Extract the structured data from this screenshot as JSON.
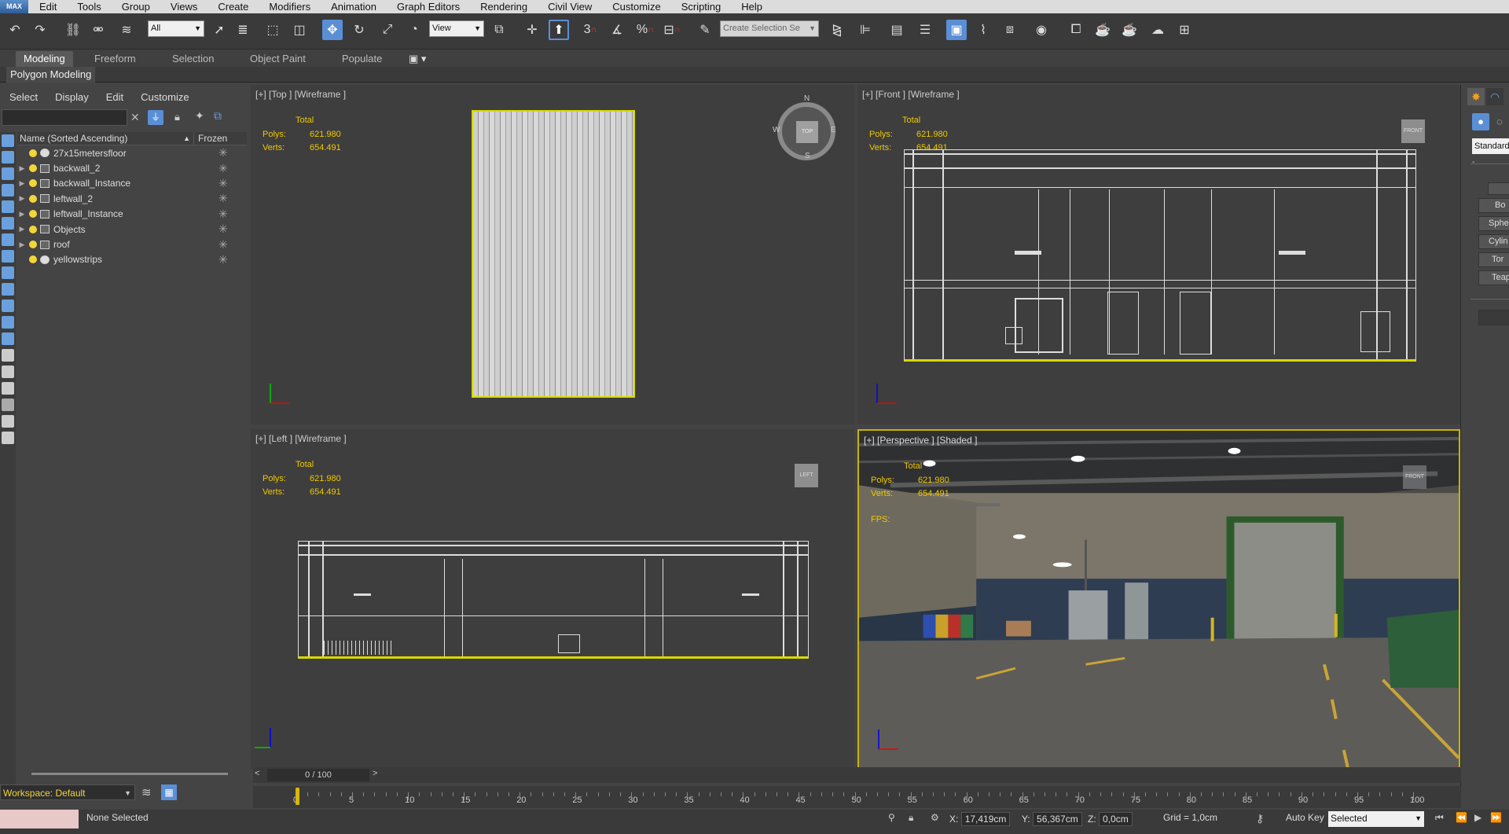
{
  "app": {
    "logo": "MAX"
  },
  "menu": [
    "Edit",
    "Tools",
    "Group",
    "Views",
    "Create",
    "Modifiers",
    "Animation",
    "Graph Editors",
    "Rendering",
    "Civil View",
    "Customize",
    "Scripting",
    "Help"
  ],
  "toolbar": {
    "filter_value": "All",
    "refcoord_value": "View",
    "selection_set_placeholder": "Create Selection Se",
    "snap_3": "3",
    "snap_percent": "%",
    "snap_n": "n"
  },
  "ribbon": {
    "tabs": [
      "Modeling",
      "Freeform",
      "Selection",
      "Object Paint",
      "Populate"
    ],
    "sub_panel": "Polygon Modeling"
  },
  "scene_explorer": {
    "menu": [
      "Select",
      "Display",
      "Edit",
      "Customize"
    ],
    "col_name": "Name (Sorted Ascending)",
    "col_frozen": "Frozen",
    "items": [
      {
        "name": "27x15metersfloor",
        "icon": "sphere",
        "expand": false
      },
      {
        "name": "backwall_2",
        "icon": "box",
        "expand": true
      },
      {
        "name": "backwall_Instance",
        "icon": "box",
        "expand": true
      },
      {
        "name": "leftwall_2",
        "icon": "box",
        "expand": true
      },
      {
        "name": "leftwall_Instance",
        "icon": "box",
        "expand": true
      },
      {
        "name": "Objects",
        "icon": "box",
        "expand": true
      },
      {
        "name": "roof",
        "icon": "box",
        "expand": true
      },
      {
        "name": "yellowstrips",
        "icon": "sphere",
        "expand": false
      }
    ]
  },
  "workspace": "Workspace: Default",
  "viewports": {
    "top": {
      "label": "[+] [Top ] [Wireframe ]"
    },
    "front": {
      "label": "[+] [Front ] [Wireframe ]"
    },
    "left": {
      "label": "[+] [Left ] [Wireframe ]"
    },
    "persp": {
      "label": "[+] [Perspective ] [Shaded ]",
      "fps": "FPS:"
    }
  },
  "stats": {
    "total": "Total",
    "polys_label": "Polys:",
    "polys": "621.980",
    "verts_label": "Verts:",
    "verts": "654.491"
  },
  "viewcube": {
    "top": "TOP",
    "front": "FRONT",
    "left": "LEFT",
    "n": "N",
    "s": "S",
    "e": "E",
    "w": "W"
  },
  "command_panel": {
    "dropdown": "Standard",
    "buttons": [
      "Bo",
      "Sphe",
      "Cylin",
      "Tor",
      "Teap"
    ]
  },
  "timeline": {
    "frame": "0 / 100",
    "ticks": [
      "0",
      "5",
      "10",
      "15",
      "20",
      "25",
      "30",
      "35",
      "40",
      "45",
      "50",
      "55",
      "60",
      "65",
      "70",
      "75",
      "80",
      "85",
      "90",
      "95",
      "100"
    ]
  },
  "status": {
    "selection": "None Selected",
    "x_label": "X:",
    "x": "17,419cm",
    "y_label": "Y:",
    "y": "56,367cm",
    "z_label": "Z:",
    "z": "0,0cm",
    "grid": "Grid = 1,0cm",
    "autokey": "Auto Key",
    "keymode": "Selected"
  },
  "colors": {
    "accent": "#5a8fd6",
    "stats_yellow": "#f0c800",
    "selection_yellow": "#c8b400"
  }
}
